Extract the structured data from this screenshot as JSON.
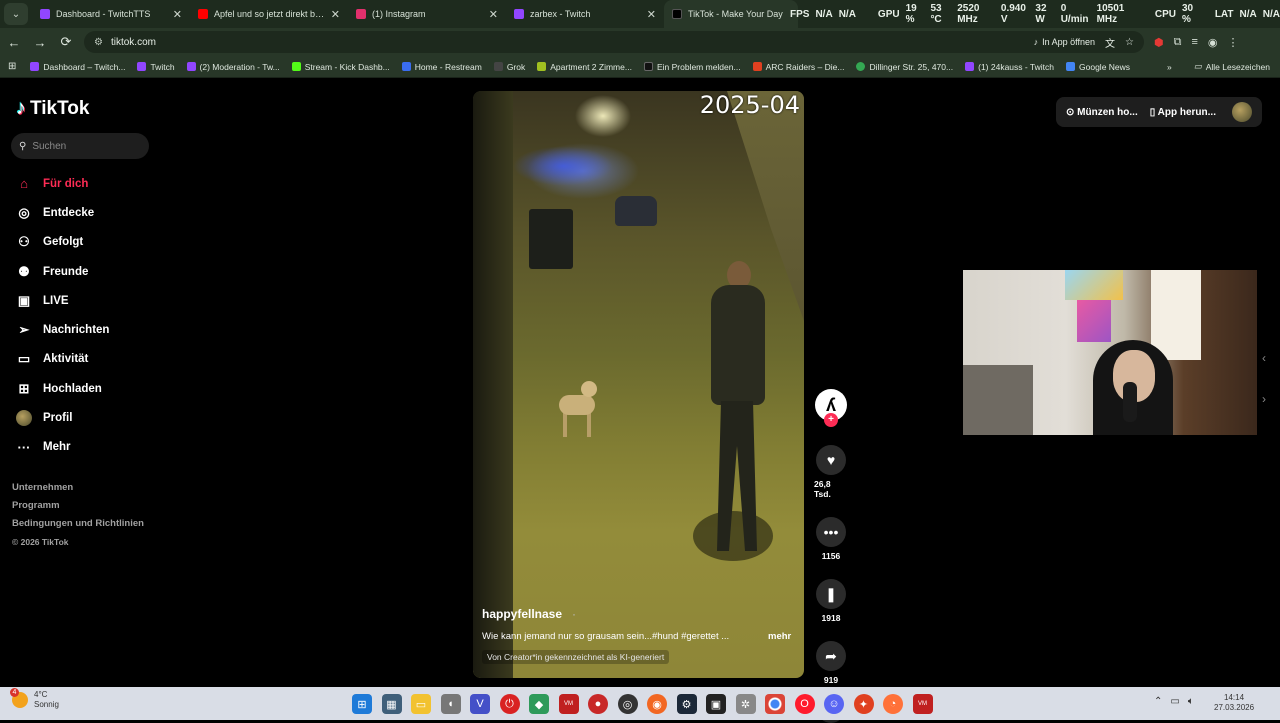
{
  "browser": {
    "tabs": [
      {
        "title": "Dashboard - TwitchTTS",
        "color": "#9146ff"
      },
      {
        "title": "Apfel und so jetzt direkt bei Du",
        "color": "#ff0000"
      },
      {
        "title": "(1) Instagram",
        "color": "#e1306c"
      },
      {
        "title": "zarbex - Twitch",
        "color": "#9146ff"
      },
      {
        "title": "TikTok - Make Your Day",
        "color": "#000000"
      }
    ],
    "hud": {
      "fps_label": "FPS",
      "fps": "N/A",
      "fps2": "N/A",
      "gpu_label": "GPU",
      "gpu_pct": "19 %",
      "gpu_temp": "53 °C",
      "gpu_mhz": "2520 MHz",
      "gpu_v": "0.940 V",
      "gpu_w": "32 W",
      "gpu_fan": "0 U/min",
      "gpu_mhz2": "10501 MHz",
      "cpu_label": "CPU",
      "cpu_pct": "30 %",
      "lat_label": "LAT",
      "lat": "N/A",
      "lat2": "N/A"
    },
    "url": "tiktok.com",
    "open_in_app": "In App öffnen",
    "bookmarks": [
      {
        "label": "Dashboard – Twitch...",
        "color": "#9146ff"
      },
      {
        "label": "Twitch",
        "color": "#9146ff"
      },
      {
        "label": "(2) Moderation - Tw...",
        "color": "#9146ff"
      },
      {
        "label": "Stream - Kick Dashb...",
        "color": "#53fc18"
      },
      {
        "label": "Home - Restream",
        "color": "#3a6df0"
      },
      {
        "label": "Grok",
        "color": "#444444"
      },
      {
        "label": "Apartment 2 Zimme...",
        "color": "#a0c020"
      },
      {
        "label": "Ein Problem melden...",
        "color": "#111111"
      },
      {
        "label": "ARC Raiders – Die...",
        "color": "#e04020"
      },
      {
        "label": "Dillinger Str. 25, 470...",
        "color": "#34a853"
      },
      {
        "label": "(1) 24kauss - Twitch",
        "color": "#9146ff"
      },
      {
        "label": "Google News",
        "color": "#4285f4"
      }
    ],
    "all_bookmarks": "Alle Lesezeichen"
  },
  "sidebar": {
    "brand": "TikTok",
    "search_placeholder": "Suchen",
    "items": [
      {
        "label": "Für dich",
        "icon": "home-icon"
      },
      {
        "label": "Entdecke",
        "icon": "compass-icon"
      },
      {
        "label": "Gefolgt",
        "icon": "user-follow-icon"
      },
      {
        "label": "Freunde",
        "icon": "friends-icon"
      },
      {
        "label": "LIVE",
        "icon": "live-icon"
      },
      {
        "label": "Nachrichten",
        "icon": "messages-icon"
      },
      {
        "label": "Aktivität",
        "icon": "activity-icon"
      },
      {
        "label": "Hochladen",
        "icon": "upload-icon"
      },
      {
        "label": "Profil",
        "icon": "avatar"
      },
      {
        "label": "Mehr",
        "icon": "more-icon"
      }
    ],
    "footer": [
      "Unternehmen",
      "Programm",
      "Bedingungen und Richtlinien"
    ],
    "copyright": "© 2026 TikTok"
  },
  "video": {
    "timestamp": "2025-04",
    "username": "happyfellnase",
    "separator": "·",
    "description": "Wie kann jemand nur so grausam sein...#hund #gerettet ...",
    "more": "mehr",
    "ai_label": "Von Creator*in gekennzeichnet als KI-generiert"
  },
  "actions": {
    "likes": "26,8 Tsd.",
    "comments": "1156",
    "saves": "1918",
    "shares": "919"
  },
  "topbar": {
    "coins": "Münzen ho...",
    "app": "App herun..."
  },
  "taskbar": {
    "temp": "4°C",
    "weather": "Sonnig",
    "badge": "4",
    "time": "14:14",
    "date": "27.03.2026"
  }
}
